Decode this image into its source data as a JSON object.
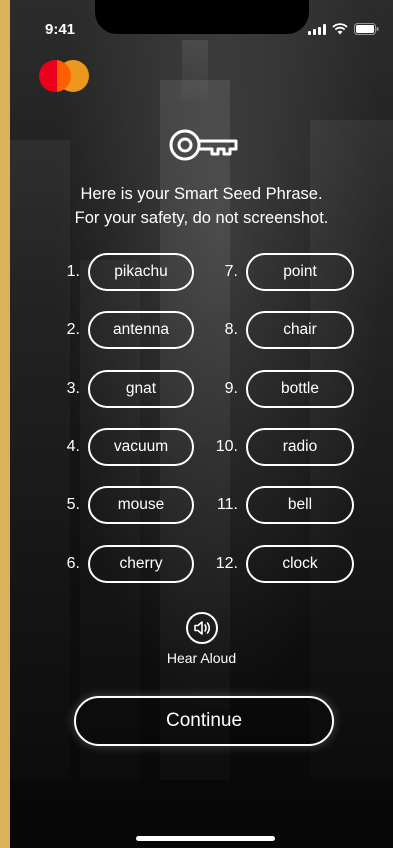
{
  "status_bar": {
    "time": "9:41"
  },
  "brand": {
    "colors": {
      "red": "#eb001b",
      "orange": "#f79e1b",
      "overlap": "#ff5f00"
    }
  },
  "header": {
    "icon": "key-icon",
    "line1": "Here is your Smart Seed Phrase.",
    "line2": "For your safety, do not screenshot."
  },
  "seed_words": [
    {
      "index": "1.",
      "word": "pikachu"
    },
    {
      "index": "2.",
      "word": "antenna"
    },
    {
      "index": "3.",
      "word": "gnat"
    },
    {
      "index": "4.",
      "word": "vacuum"
    },
    {
      "index": "5.",
      "word": "mouse"
    },
    {
      "index": "6.",
      "word": "cherry"
    },
    {
      "index": "7.",
      "word": "point"
    },
    {
      "index": "8.",
      "word": "chair"
    },
    {
      "index": "9.",
      "word": "bottle"
    },
    {
      "index": "10.",
      "word": "radio"
    },
    {
      "index": "11.",
      "word": "bell"
    },
    {
      "index": "12.",
      "word": "clock"
    }
  ],
  "hear_aloud": {
    "icon": "speaker-icon",
    "label": "Hear Aloud"
  },
  "continue": {
    "label": "Continue"
  }
}
